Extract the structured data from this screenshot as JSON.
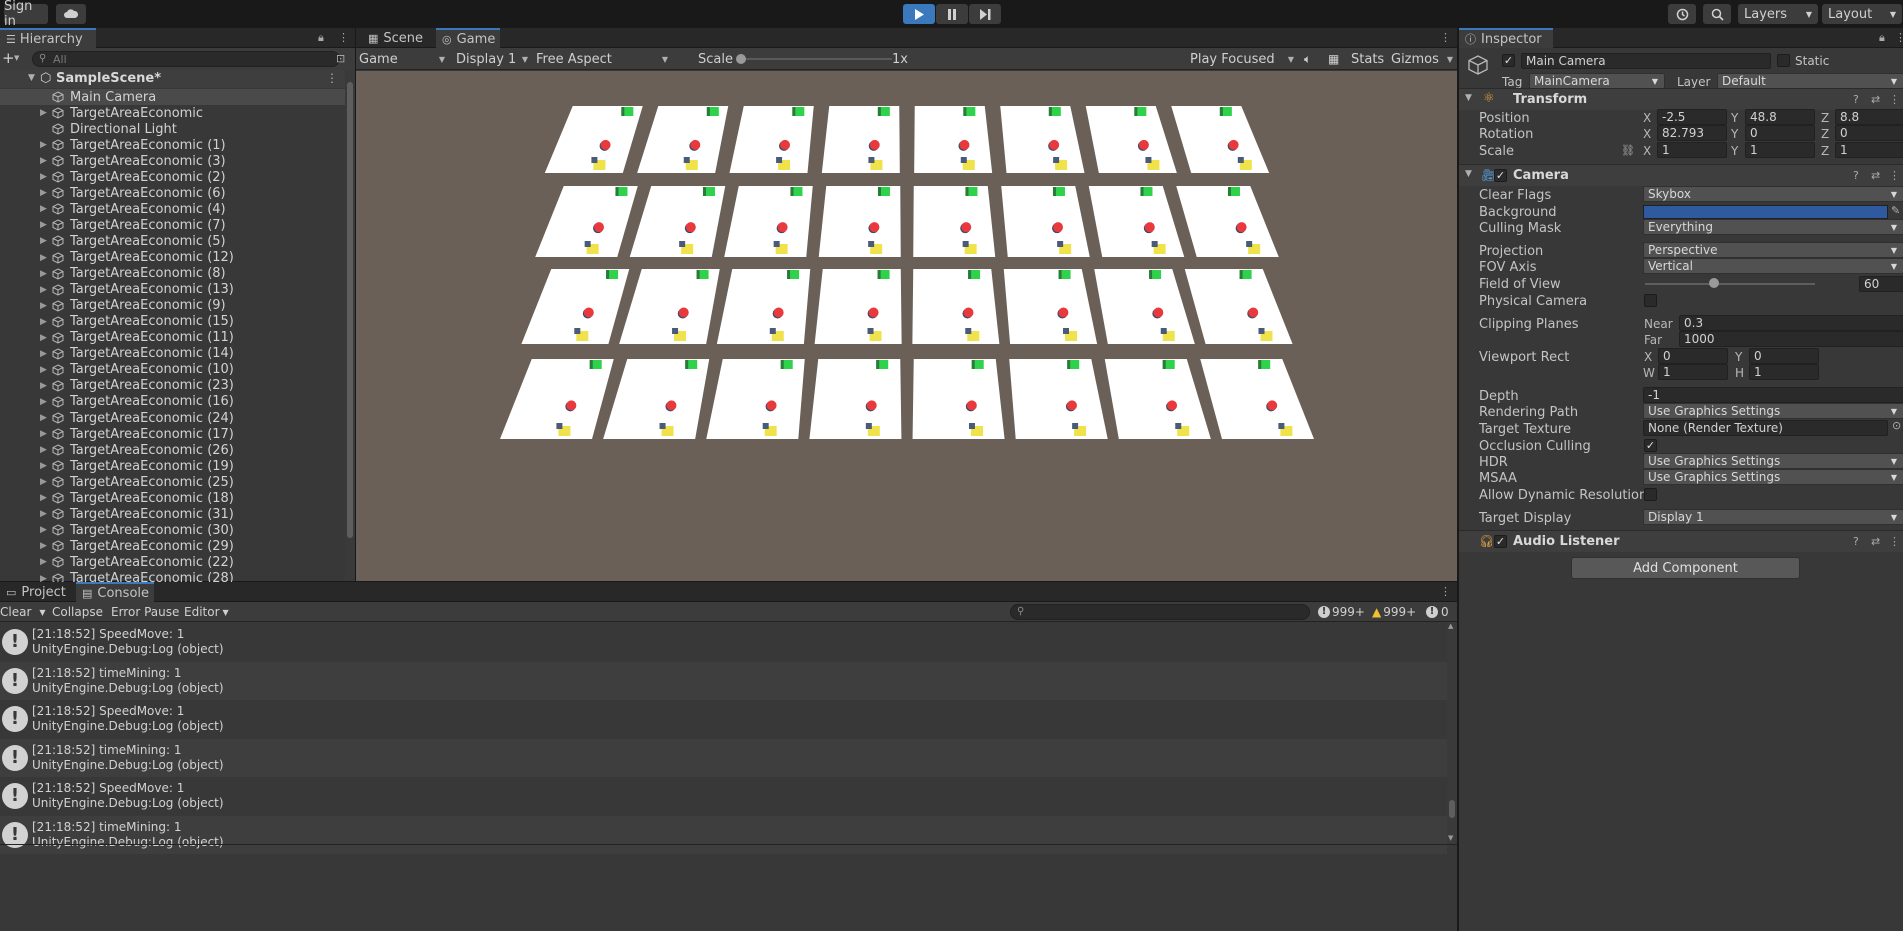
{
  "toolbar": {
    "sign_in": "Sign in",
    "layers": "Layers",
    "layout": "Layout",
    "icons": [
      "cloud-icon",
      "play-icon",
      "pause-icon",
      "step-icon",
      "history-icon",
      "search-icon"
    ]
  },
  "hierarchy": {
    "tab": "Hierarchy",
    "search_placeholder": "All",
    "scene": "SampleScene*",
    "items": [
      {
        "label": "Main Camera",
        "expandable": false,
        "selected": true
      },
      {
        "label": "TargetAreaEconomic",
        "expandable": true
      },
      {
        "label": "Directional Light",
        "expandable": false
      },
      {
        "label": "TargetAreaEconomic (1)",
        "expandable": true
      },
      {
        "label": "TargetAreaEconomic (3)",
        "expandable": true
      },
      {
        "label": "TargetAreaEconomic (2)",
        "expandable": true
      },
      {
        "label": "TargetAreaEconomic (6)",
        "expandable": true
      },
      {
        "label": "TargetAreaEconomic (4)",
        "expandable": true
      },
      {
        "label": "TargetAreaEconomic (7)",
        "expandable": true
      },
      {
        "label": "TargetAreaEconomic (5)",
        "expandable": true
      },
      {
        "label": "TargetAreaEconomic (12)",
        "expandable": true
      },
      {
        "label": "TargetAreaEconomic (8)",
        "expandable": true
      },
      {
        "label": "TargetAreaEconomic (13)",
        "expandable": true
      },
      {
        "label": "TargetAreaEconomic (9)",
        "expandable": true
      },
      {
        "label": "TargetAreaEconomic (15)",
        "expandable": true
      },
      {
        "label": "TargetAreaEconomic (11)",
        "expandable": true
      },
      {
        "label": "TargetAreaEconomic (14)",
        "expandable": true
      },
      {
        "label": "TargetAreaEconomic (10)",
        "expandable": true
      },
      {
        "label": "TargetAreaEconomic (23)",
        "expandable": true
      },
      {
        "label": "TargetAreaEconomic (16)",
        "expandable": true
      },
      {
        "label": "TargetAreaEconomic (24)",
        "expandable": true
      },
      {
        "label": "TargetAreaEconomic (17)",
        "expandable": true
      },
      {
        "label": "TargetAreaEconomic (26)",
        "expandable": true
      },
      {
        "label": "TargetAreaEconomic (19)",
        "expandable": true
      },
      {
        "label": "TargetAreaEconomic (25)",
        "expandable": true
      },
      {
        "label": "TargetAreaEconomic (18)",
        "expandable": true
      },
      {
        "label": "TargetAreaEconomic (31)",
        "expandable": true
      },
      {
        "label": "TargetAreaEconomic (30)",
        "expandable": true
      },
      {
        "label": "TargetAreaEconomic (29)",
        "expandable": true
      },
      {
        "label": "TargetAreaEconomic (22)",
        "expandable": true
      },
      {
        "label": "TargetAreaEconomic (28)",
        "expandable": true
      }
    ]
  },
  "game": {
    "tabs": [
      "Scene",
      "Game"
    ],
    "active_tab": "Game",
    "view_mode": "Game",
    "display": "Display 1",
    "aspect": "Free Aspect",
    "scale_label": "Scale",
    "scale_value": "1x",
    "play_mode": "Play Focused",
    "stats": "Stats",
    "gizmos": "Gizmos",
    "grid_rows": 4,
    "grid_cols": 8,
    "colors": {
      "floor": "#6b6057",
      "tile": "#ffffff",
      "agent": "#e8393c",
      "goal": "#2fd24b",
      "box": "#f0e24a"
    }
  },
  "inspector": {
    "tab": "Inspector",
    "object_name": "Main Camera",
    "static": "Static",
    "tag_label": "Tag",
    "tag_value": "MainCamera",
    "layer_label": "Layer",
    "layer_value": "Default",
    "transform": {
      "title": "Transform",
      "position_label": "Position",
      "rotation_label": "Rotation",
      "scale_label": "Scale",
      "position": [
        "-2.5",
        "48.8",
        "8.8"
      ],
      "rotation": [
        "82.793",
        "0",
        "0"
      ],
      "scale": [
        "1",
        "1",
        "1"
      ]
    },
    "camera": {
      "title": "Camera",
      "clear_flags_label": "Clear Flags",
      "clear_flags": "Skybox",
      "background_label": "Background",
      "background_color": "#2f5aa0",
      "culling_mask_label": "Culling Mask",
      "culling_mask": "Everything",
      "projection_label": "Projection",
      "projection": "Perspective",
      "fov_axis_label": "FOV Axis",
      "fov_axis": "Vertical",
      "fov_label": "Field of View",
      "fov": "60",
      "physical_label": "Physical Camera",
      "clipping_label": "Clipping Planes",
      "near_label": "Near",
      "near": "0.3",
      "far_label": "Far",
      "far": "1000",
      "viewport_label": "Viewport Rect",
      "vx": "0",
      "vy": "0",
      "vw": "1",
      "vh": "1",
      "depth_label": "Depth",
      "depth": "-1",
      "rendering_label": "Rendering Path",
      "rendering": "Use Graphics Settings",
      "target_texture_label": "Target Texture",
      "target_texture": "None (Render Texture)",
      "occlusion_label": "Occlusion Culling",
      "hdr_label": "HDR",
      "hdr": "Use Graphics Settings",
      "msaa_label": "MSAA",
      "msaa": "Use Graphics Settings",
      "dynres_label": "Allow Dynamic Resolution",
      "target_display_label": "Target Display",
      "target_display": "Display 1"
    },
    "audio_listener": "Audio Listener",
    "add_component": "Add Component"
  },
  "console": {
    "tabs": [
      "Project",
      "Console"
    ],
    "active_tab": "Console",
    "clear": "Clear",
    "collapse": "Collapse",
    "error_pause": "Error Pause",
    "editor": "Editor",
    "count_log": "999+",
    "count_warn": "999+",
    "count_error": "0",
    "entries": [
      {
        "line1": "[21:18:52] SpeedMove: 1",
        "line2": "UnityEngine.Debug:Log (object)"
      },
      {
        "line1": "[21:18:52] timeMining: 1",
        "line2": "UnityEngine.Debug:Log (object)"
      },
      {
        "line1": "[21:18:52] SpeedMove: 1",
        "line2": "UnityEngine.Debug:Log (object)"
      },
      {
        "line1": "[21:18:52] timeMining: 1",
        "line2": "UnityEngine.Debug:Log (object)"
      },
      {
        "line1": "[21:18:52] SpeedMove: 1",
        "line2": "UnityEngine.Debug:Log (object)"
      },
      {
        "line1": "[21:18:52] timeMining: 1",
        "line2": "UnityEngine.Debug:Log (object)"
      }
    ]
  }
}
